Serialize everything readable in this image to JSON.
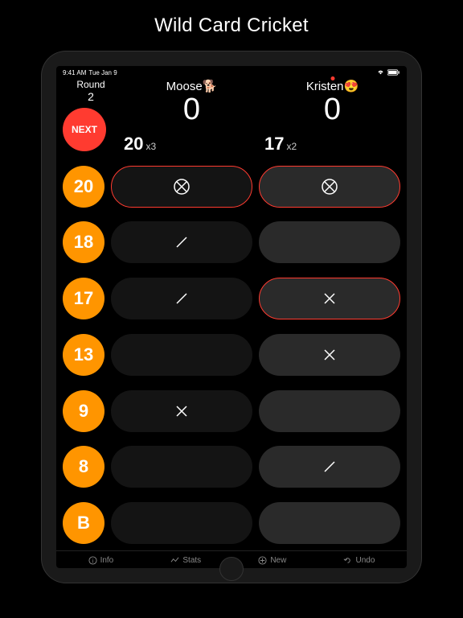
{
  "title": "Wild Card Cricket",
  "status": {
    "time": "9:41 AM",
    "date": "Tue Jan 9"
  },
  "round": {
    "label": "Round",
    "number": "2"
  },
  "next_label": "NEXT",
  "players": [
    {
      "name": "Moose🐕",
      "score": "0",
      "wild_num": "20",
      "wild_mul": "x3",
      "active": false
    },
    {
      "name": "Kristen😍",
      "score": "0",
      "wild_num": "17",
      "wild_mul": "x2",
      "active": true
    }
  ],
  "targets": [
    {
      "label": "20",
      "marks": [
        "closed",
        "closed"
      ]
    },
    {
      "label": "18",
      "marks": [
        "one",
        ""
      ]
    },
    {
      "label": "17",
      "marks": [
        "one",
        "two-closed"
      ]
    },
    {
      "label": "13",
      "marks": [
        "",
        "two"
      ]
    },
    {
      "label": "9",
      "marks": [
        "two",
        ""
      ]
    },
    {
      "label": "8",
      "marks": [
        "",
        "one"
      ]
    },
    {
      "label": "B",
      "marks": [
        "",
        ""
      ]
    }
  ],
  "footer": {
    "info": "Info",
    "stats": "Stats",
    "new": "New",
    "undo": "Undo"
  }
}
